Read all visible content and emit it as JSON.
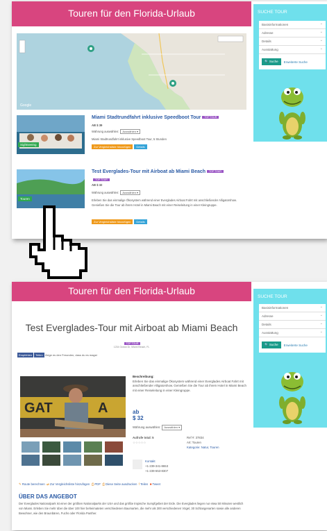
{
  "header": {
    "title": "Touren für den Florida-Urlaub"
  },
  "sidebar": {
    "title": "SUCHE TOUR",
    "selects": [
      "Basisinformationen",
      "Adresse",
      "Details",
      "Ausstattung"
    ],
    "search_button": "Suche",
    "advanced_link": "Erweiterte Suche"
  },
  "map": {
    "watermark": "Google",
    "toggle": "Karte"
  },
  "tours": [
    {
      "title": "Miami Stadtrundfahrt inklusive Speedboot Tour",
      "badge": "TOP TOUR",
      "tag": "Sightseeing",
      "price": "AB $ 39",
      "currency_label": "Währung auswählen:",
      "currency_option": "Auswählen",
      "desc": "Miami Stadtrundfahrt inklusive Speedboot Tour, 5 Stunden",
      "compare_button": "Zur Vergleichsliste hinzufügen",
      "details_button": "Details"
    },
    {
      "title": "Test Everglades-Tour mit Airboat ab Miami Beach",
      "badge": "TOP TOUR",
      "tag": "Touren",
      "price": "AB $ 32",
      "currency_label": "Währung auswählen:",
      "currency_option": "Auswählen",
      "desc": "Erleben Sie das einmalige Ökosystem während einer Everglades Airboat Fahrt mit anschließender Alligatorshow. Genießen Sie die Tour ab ihrem Hotel in Miami Beach mit einer Reiseleitung in einer Kleingruppe.",
      "compare_button": "Zur Vergleichsliste hinzufügen",
      "details_button": "Details"
    }
  ],
  "detail": {
    "title": "Test Everglades-Tour mit Airboat ab Miami Beach",
    "badge": "TOP TOUR",
    "address": "1234 Ocean Dr, Miami Beach, FL",
    "fb_label": "Empfehlen",
    "fb_share": "Teilen",
    "fb_text": "Zeige es den Freunden, dass du es magst",
    "desc_label": "Beschreibung:",
    "desc": "Erleben Sie das einmalige Ökosystem während einer Everglades Airboat Fahrt mit anschließender Alligatorshow. Genießen Sie die Tour ab ihrem Hotel in Miami Beach mit einer Reiseleitung in einer Kleingruppe.",
    "price_prefix": "ab",
    "price": "$ 32",
    "currency_label": "Währung auswählen:",
    "currency_option": "Auswählen",
    "rating_label": "Aufrufe total: 5",
    "ref": "Ref #: 37834",
    "type": "Art: Touren",
    "category": "Kategorie: Natur, Touren",
    "contact_label": "Kontakt",
    "phone1": "+1-239-341-8653",
    "phone2": "+1-239-653-8307",
    "actions": [
      "Route berechnen",
      "Zur Vergleichsliste hinzufügen",
      "PDF",
      "Diese Seite ausdrucken",
      "Teilen",
      "Tweet"
    ],
    "about_title": "ÜBER DAS ANGEBOT",
    "about_text": "Der Everglades Nationalpark ist einer der größten Nationalparks der USA und das größte tropische Sumpfgebiet der Erde. Die Everglades liegen nur etwa 50 Minuten westlich von Miami. Erleben Sie mehr über die über 100 hier beheimateten verschiedenen Baumarten, die mehr als 300 verschiedenen Vögel, 30 Schlangenarten sowie alle anderen Bewohner, wie den Braunbären, Fuchs oder Florida Panther."
  },
  "colors": {
    "banner": "#d8457f",
    "sidebar": "#6fe0ec",
    "link": "#2a5aa5",
    "badge": "#9a55c4"
  }
}
